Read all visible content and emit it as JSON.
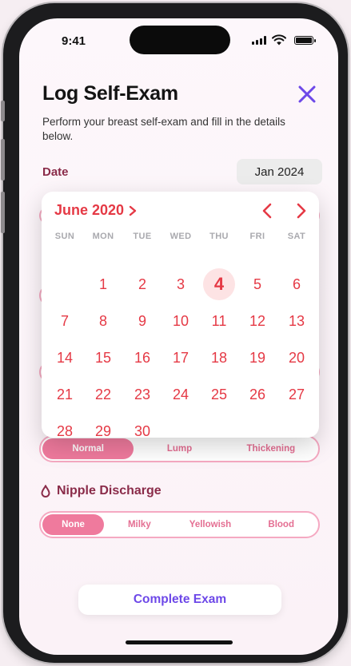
{
  "status": {
    "time": "9:41"
  },
  "header": {
    "title": "Log Self-Exam",
    "subtitle": "Perform your breast self-exam and fill in the details below."
  },
  "date": {
    "label": "Date",
    "value": "Jan 2024"
  },
  "calendar": {
    "month_label": "June 2020",
    "weekdays": [
      "SUN",
      "MON",
      "TUE",
      "WED",
      "THU",
      "FRI",
      "SAT"
    ],
    "first_weekday_index": 1,
    "days_in_month": 30,
    "selected_day": 4,
    "accent": "#e53945"
  },
  "texture": {
    "options": [
      "Normal",
      "Lump",
      "Thickening"
    ],
    "selected": "Normal"
  },
  "nipple_discharge": {
    "label": "Nipple Discharge",
    "options": [
      "None",
      "Milky",
      "Yellowish",
      "Blood"
    ],
    "selected": "None"
  },
  "footer": {
    "complete_label": "Complete Exam"
  },
  "colors": {
    "accent_pink": "#ef7a9d",
    "label_maroon": "#8a2b49",
    "purple": "#6d48e8"
  }
}
